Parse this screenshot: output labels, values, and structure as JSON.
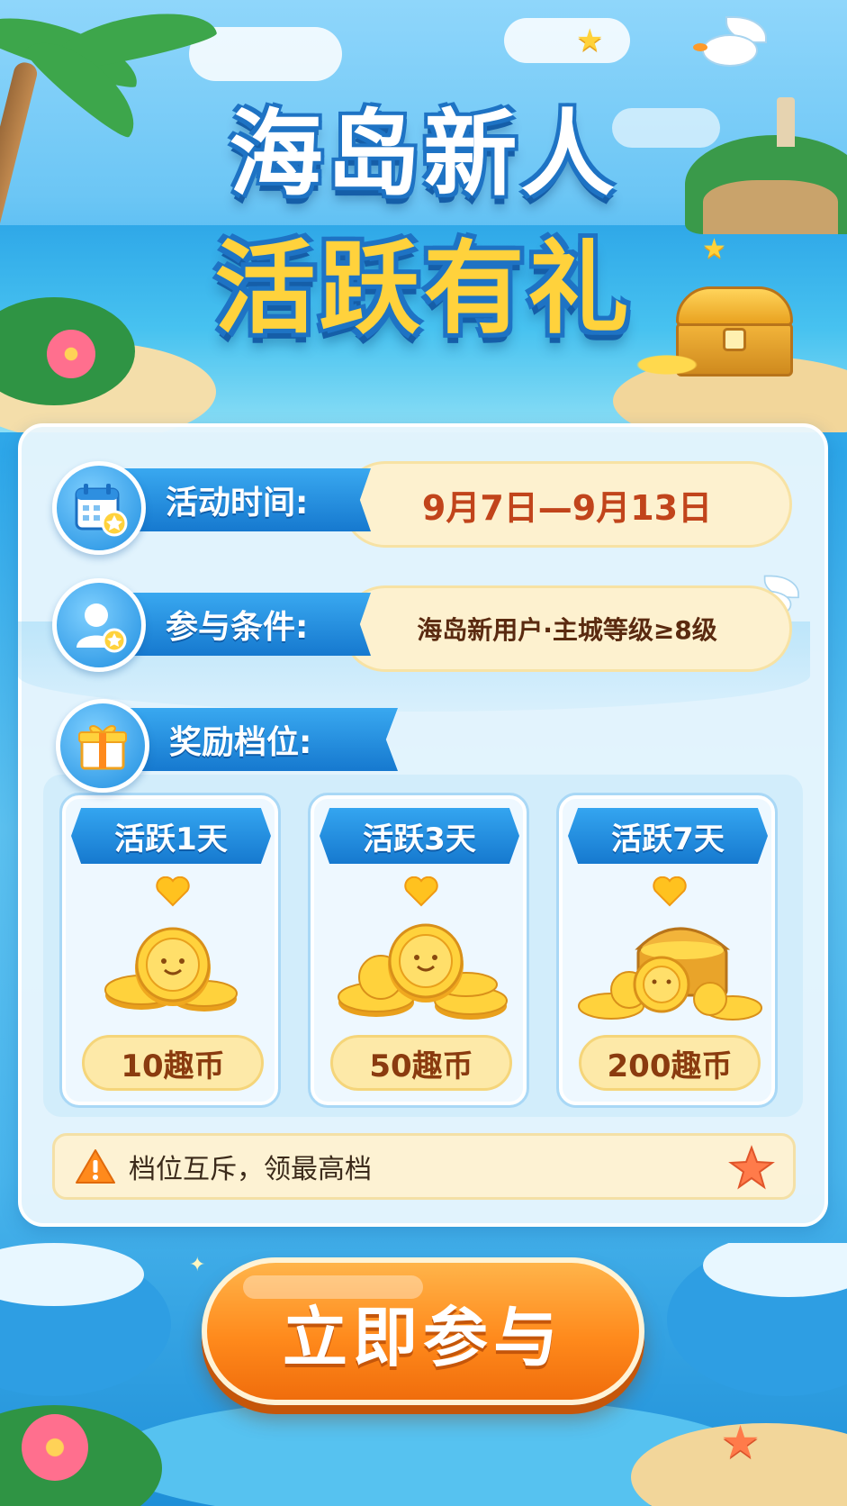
{
  "event_title": {
    "line1": "海岛新人",
    "line2": "活跃有礼"
  },
  "info": {
    "time": {
      "label": "活动时间:",
      "value": "9月7日—9月13日",
      "icon": "calendar-star-icon"
    },
    "condition": {
      "label": "参与条件:",
      "value": "海岛新用户·主城等级≥8级",
      "icon": "user-star-icon"
    },
    "rewards": {
      "label": "奖励档位:",
      "icon": "gift-box-icon"
    }
  },
  "tiers": [
    {
      "label": "活跃1天",
      "amount": "10趣币",
      "art": "small-coin-stack-icon"
    },
    {
      "label": "活跃3天",
      "amount": "50趣币",
      "art": "coin-pile-icon"
    },
    {
      "label": "活跃7天",
      "amount": "200趣币",
      "art": "treasure-chest-icon"
    }
  ],
  "notice": {
    "text": "档位互斥，领最高档",
    "icon": "warning-icon"
  },
  "cta": {
    "label": "立即参与"
  },
  "colors": {
    "accent_blue": "#1679cf",
    "accent_orange": "#ff8a1c",
    "title_gold": "#ffd23c",
    "value_red": "#c1441b"
  }
}
